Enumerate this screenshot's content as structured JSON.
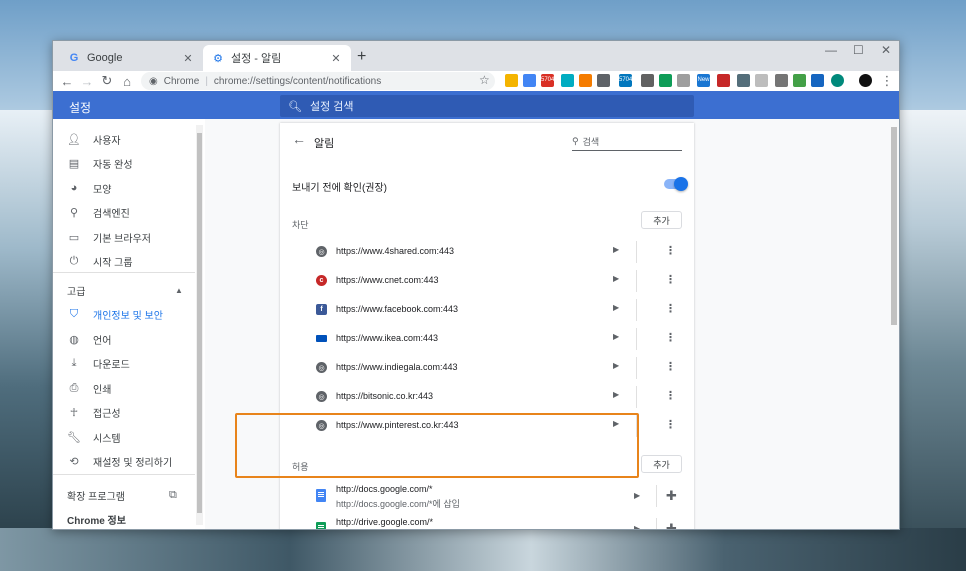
{
  "tabs": [
    {
      "title": "Google",
      "favicon": "G"
    },
    {
      "title": "설정 - 알림",
      "favicon": "⚙"
    }
  ],
  "toolbar": {
    "chip": "Chrome",
    "url": "chrome://settings/content/notifications"
  },
  "header": {
    "title": "설정",
    "search_placeholder": "설정 검색"
  },
  "sidebar": {
    "items": [
      {
        "label": "사용자",
        "icon": "person-icon"
      },
      {
        "label": "자동 완성",
        "icon": "clipboard-icon"
      },
      {
        "label": "모양",
        "icon": "palette-icon"
      },
      {
        "label": "검색엔진",
        "icon": "search-icon"
      },
      {
        "label": "기본 브라우저",
        "icon": "browser-icon"
      },
      {
        "label": "시작 그룹",
        "icon": "power-icon"
      }
    ],
    "advanced_label": "고급",
    "advanced_items": [
      {
        "label": "개인정보 및 보안",
        "icon": "shield-icon"
      },
      {
        "label": "언어",
        "icon": "globe-icon"
      },
      {
        "label": "다운로드",
        "icon": "download-icon"
      },
      {
        "label": "인쇄",
        "icon": "print-icon"
      },
      {
        "label": "접근성",
        "icon": "accessibility-icon"
      },
      {
        "label": "시스템",
        "icon": "wrench-icon"
      },
      {
        "label": "재설정 및 정리하기",
        "icon": "restore-icon"
      }
    ],
    "extensions_label": "확장 프로그램",
    "about_label": "Chrome 정보"
  },
  "page": {
    "title": "알림",
    "search_placeholder": "검색",
    "ask_label": "보내기 전에 확인(권장)",
    "block_label": "차단",
    "allow_label": "허용",
    "add_label": "추가"
  },
  "blocked_sites": [
    {
      "url": "https://www.4shared.com:443",
      "icon": "globe-icon"
    },
    {
      "url": "https://www.cnet.com:443",
      "icon": "cnet-icon"
    },
    {
      "url": "https://www.facebook.com:443",
      "icon": "facebook-icon"
    },
    {
      "url": "https://www.ikea.com:443",
      "icon": "ikea-icon"
    },
    {
      "url": "https://www.indiegala.com:443",
      "icon": "globe-icon"
    },
    {
      "url": "https://bitsonic.co.kr:443",
      "icon": "globe-icon"
    },
    {
      "url": "https://www.pinterest.co.kr:443",
      "icon": "globe-icon"
    }
  ],
  "allowed_sites": [
    {
      "url": "http://docs.google.com/*",
      "sub": "http://docs.google.com/*에 삽입"
    },
    {
      "url": "http://drive.google.com/*",
      "sub": ""
    }
  ],
  "ext_badges": {
    "badge1": "5704",
    "badge2": "5704",
    "badge3": "New"
  },
  "colors": {
    "accent": "#1a73e8",
    "header": "#3c6fd1",
    "highlight": "#e8841b"
  }
}
